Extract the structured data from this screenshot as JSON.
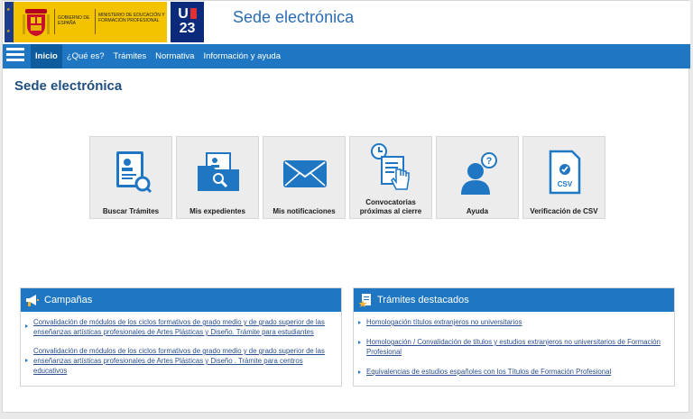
{
  "header": {
    "gov_text": "GOBIERNO DE ESPAÑA",
    "ministry_text": "MINISTERIO DE EDUCACIÓN Y FORMACIÓN PROFESIONAL",
    "eu_badge": "U 23",
    "site_title": "Sede electrónica"
  },
  "nav": {
    "items": [
      "Inicio",
      "¿Qué es?",
      "Trámites",
      "Normativa",
      "Información y ayuda"
    ]
  },
  "page_title": "Sede electrónica",
  "tiles": [
    {
      "label": "Buscar Trámites",
      "icon": "search-document-icon"
    },
    {
      "label": "Mis expedientes",
      "icon": "folder-search-icon"
    },
    {
      "label": "Mis notificaciones",
      "icon": "envelope-icon"
    },
    {
      "label": "Convocatorias próximas al cierre",
      "icon": "clock-document-icon"
    },
    {
      "label": "Ayuda",
      "icon": "user-help-icon"
    },
    {
      "label": "Verificación de CSV",
      "icon": "csv-document-icon"
    }
  ],
  "campanas": {
    "title": "Campañas",
    "items": [
      "Convalidación de módulos de los ciclos formativos de grado medio y de grado superior de las enseñanzas artísticas profesionales de Artes Plásticas y Diseño. Trámite para estudiantes",
      "Convalidación de módulos de los ciclos formativos de grado medio y de grado superior de las enseñanzas artísticas profesionales de Artes Plásticas y Diseño . Trámite para centros educativos"
    ]
  },
  "tramites": {
    "title": "Trámites destacados",
    "items": [
      "Homologación títulos extranjeros no universitarios",
      "Homologación / Convalidación de títulos y estudios extranjeros no universitarios de Formación Profesional",
      "Equivalencias de estudios españoles con los Títulos de Formación Profesional"
    ]
  },
  "colors": {
    "accent": "#1f77c3",
    "header_title": "#2a6db5",
    "gov_yellow": "#f3c300",
    "eu_blue": "#0b2a7b"
  }
}
